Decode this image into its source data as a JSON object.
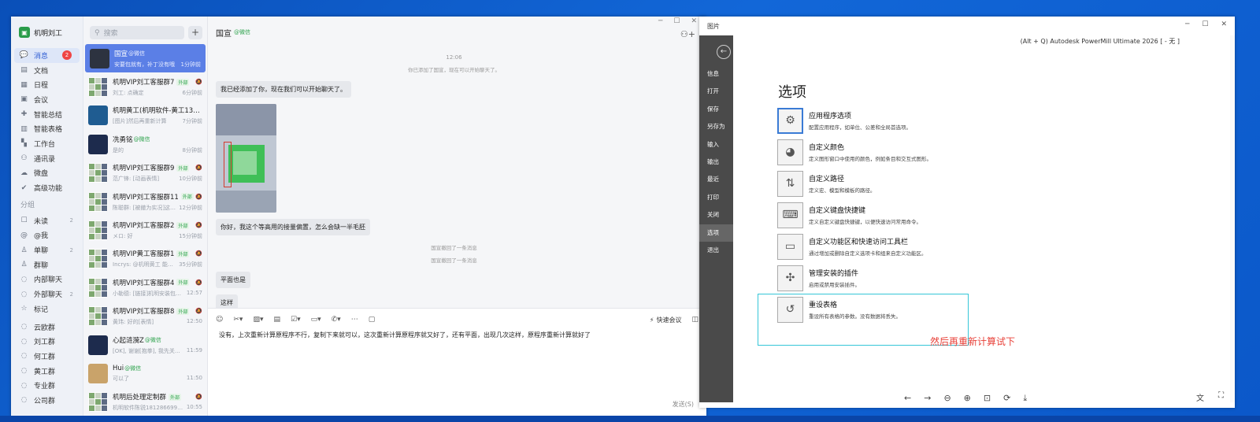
{
  "wecom": {
    "profile_name": "机明刘工",
    "nav_items": [
      {
        "icon": "💬",
        "icon_name": "message-icon",
        "label": "消息",
        "badge": "2"
      },
      {
        "icon": "▤",
        "icon_name": "document-icon",
        "label": "文档"
      },
      {
        "icon": "▦",
        "icon_name": "calendar-icon",
        "label": "日程"
      },
      {
        "icon": "▣",
        "icon_name": "meeting-icon",
        "label": "会议"
      },
      {
        "icon": "✚",
        "icon_name": "smart-summary-icon",
        "label": "智能总结"
      },
      {
        "icon": "▥",
        "icon_name": "smart-table-icon",
        "label": "智能表格"
      },
      {
        "icon": "▚",
        "icon_name": "workbench-icon",
        "label": "工作台"
      },
      {
        "icon": "⚇",
        "icon_name": "contacts-icon",
        "label": "通讯录"
      },
      {
        "icon": "☁",
        "icon_name": "drive-icon",
        "label": "微盘"
      },
      {
        "icon": "✔",
        "icon_name": "advanced-icon",
        "label": "高级功能"
      }
    ],
    "group_section_label": "分组",
    "group_items": [
      {
        "icon": "☐",
        "icon_name": "unread-icon",
        "label": "未读",
        "count": "2"
      },
      {
        "icon": "@",
        "icon_name": "mention-icon",
        "label": "@我"
      },
      {
        "icon": "♙",
        "icon_name": "single-chat-icon",
        "label": "单聊",
        "count": "2"
      },
      {
        "icon": "♙",
        "icon_name": "group-chat-icon",
        "label": "群聊"
      },
      {
        "icon": "◌",
        "icon_name": "internal-chat-icon",
        "label": "内部聊天"
      },
      {
        "icon": "◌",
        "icon_name": "external-chat-icon",
        "label": "外部聊天",
        "count": "2"
      },
      {
        "icon": "☆",
        "icon_name": "star-icon",
        "label": "标记"
      }
    ],
    "folder_items": [
      {
        "icon": "◌",
        "label": "云欧群"
      },
      {
        "icon": "◌",
        "label": "刘工群"
      },
      {
        "icon": "◌",
        "label": "何工群"
      },
      {
        "icon": "◌",
        "label": "黄工群"
      },
      {
        "icon": "◌",
        "label": "专业群"
      },
      {
        "icon": "◌",
        "label": "公司群"
      }
    ],
    "search_placeholder": "搜索",
    "add_label": "+",
    "conversations": [
      {
        "name": "国宣",
        "ext": "@微信",
        "preview": "安要包就有，补丁没有哦",
        "time": "1分钟前",
        "active": true,
        "avatar": "dark"
      },
      {
        "name": "机明VIP刘工客服群7",
        "tag": "外部",
        "preview": "刘工: 点确定",
        "time": "6分钟前",
        "avatar": "grid"
      },
      {
        "name": "机明黄工(机明软件-黄工13688...",
        "preview": "[图片]然后再重新计算",
        "time": "7分钟前",
        "avatar": "green"
      },
      {
        "name": "冼勇铭",
        "ext": "@微信",
        "preview": "是的",
        "time": "8分钟前",
        "avatar": "space"
      },
      {
        "name": "机明VIP刘工客服群9",
        "tag": "外部",
        "preview": "范广锋: [动画表情]",
        "time": "10分钟前",
        "avatar": "grid"
      },
      {
        "name": "机明VIP刘工客服群11",
        "tag": "外部",
        "preview": "陈聪群: [被撤为实况]这样...",
        "time": "12分钟前",
        "avatar": "grid"
      },
      {
        "name": "机明VIP刘工客服群2",
        "tag": "外部",
        "preview": "メロ: 好",
        "time": "15分钟前",
        "avatar": "grid"
      },
      {
        "name": "机明VIP黄工客服群1",
        "tag": "外部",
        "preview": "Incrys: @机明黄工 能定...",
        "time": "35分钟前",
        "avatar": "grid"
      },
      {
        "name": "机明VIP刘工客服群4",
        "tag": "外部",
        "preview": "小勒德: [链接]机明安装包和...",
        "time": "12:57",
        "avatar": "grid"
      },
      {
        "name": "机明VIP刘工客服群8",
        "tag": "外部",
        "preview": "黄玮: 好的[表情]",
        "time": "12:50",
        "avatar": "grid"
      },
      {
        "name": "心起涟漪Z",
        "ext": "@微信",
        "preview": "[OK], 谢谢[抱拳], 我先关...",
        "time": "11:59",
        "avatar": "space"
      },
      {
        "name": "Hui",
        "ext": "@微信",
        "preview": "可以了",
        "time": "11:50",
        "avatar": "photo"
      },
      {
        "name": "机明后处理定制群",
        "tag": "外部",
        "preview": "机明软件陈锐1812866998...",
        "time": "10:55",
        "avatar": "grid"
      }
    ],
    "chat": {
      "title": "国宣",
      "title_ext": "@微信",
      "time_label": "12:06",
      "system_added": "你已添加了国宣，现在可以开始聊天了。",
      "msg_greeting": "我已经添加了你，现在我们可以开始聊天了。",
      "msg_question": "你好，我这个等高用的接量偏置，怎么会缺一半毛胚",
      "recall_1": "国宣撤回了一条消息",
      "recall_2": "国宣撤回了一条消息",
      "msg_plane": "平面也是",
      "msg_like_this": "这样",
      "input_text": "没有，上次重新计算原程序不行，复制下来就可以，这次重新计算原程序就又好了，还有平面，出现几次这样，原程序重新计算就好了",
      "quick_meeting": "快速会议",
      "send_label": "发送(S)"
    }
  },
  "photos": {
    "window_title": "图片",
    "caption": "(Alt + Q) Autodesk PowerMill Ultimate 2026   [ - 无 ]",
    "backstage_items": [
      "信息",
      "打开",
      "保存",
      "另存为",
      "输入",
      "输出",
      "最近",
      "打印",
      "关闭",
      "选项",
      "退出"
    ],
    "active_backstage": "选项",
    "options_title": "选项",
    "options": [
      {
        "icon": "⚙",
        "icon_name": "gear-icon",
        "name": "应用程序选项",
        "desc": "配置应用程序，如单位、公差和全局首选项。"
      },
      {
        "icon": "◕",
        "icon_name": "color-wheel-icon",
        "name": "自定义颜色",
        "desc": "定义图形窗口中使用的颜色，例如条目和交互式图形。"
      },
      {
        "icon": "⇅",
        "icon_name": "path-icon",
        "name": "自定义路径",
        "desc": "定义宏、模型和模板的路径。"
      },
      {
        "icon": "⌨",
        "icon_name": "keyboard-icon",
        "name": "自定义键盘快捷键",
        "desc": "定义自定义键盘快捷键，以便快速访问常用命令。"
      },
      {
        "icon": "▭",
        "icon_name": "ribbon-icon",
        "name": "自定义功能区和快速访问工具栏",
        "desc": "通过增加或删除自定义选项卡和组来自定义功能区。"
      },
      {
        "icon": "✣",
        "icon_name": "plugin-icon",
        "name": "管理安装的插件",
        "desc": "启用或禁用安装插件。"
      },
      {
        "icon": "↺",
        "icon_name": "reset-icon",
        "name": "重设表格",
        "desc": "重设所有表格的参数。没有数据将丢失。"
      }
    ],
    "annotation": "然后再重新计算试下"
  },
  "colors": {
    "accent": "#5b7fe6",
    "annotation": "#e8423a",
    "highlight": "#35c6d8"
  }
}
